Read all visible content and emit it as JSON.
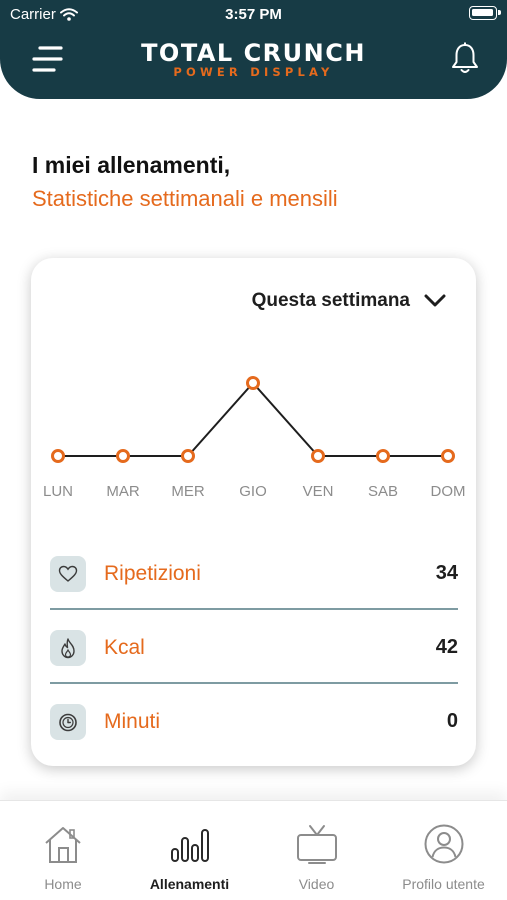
{
  "status_bar": {
    "carrier": "Carrier",
    "time": "3:57 PM"
  },
  "header": {
    "logo_title": "TOTAL CRUNCH",
    "logo_subtitle": "POWER DISPLAY"
  },
  "page": {
    "title": "I miei allenamenti,",
    "subtitle": "Statistiche settimanali e mensili"
  },
  "card": {
    "period_selected": "Questa settimana",
    "stats": [
      {
        "label": "Ripetizioni",
        "value": "34",
        "icon": "heart-icon"
      },
      {
        "label": "Kcal",
        "value": "42",
        "icon": "flame-icon"
      },
      {
        "label": "Minuti",
        "value": "0",
        "icon": "stopwatch-icon"
      }
    ]
  },
  "chart_data": {
    "type": "line",
    "categories": [
      "LUN",
      "MAR",
      "MER",
      "GIO",
      "VEN",
      "SAB",
      "DOM"
    ],
    "values": [
      0,
      0,
      0,
      1,
      0,
      0,
      0
    ],
    "ylim": [
      0,
      1
    ],
    "grid": false,
    "line_color": "#1e1e1e",
    "marker_color": "#e56a1d"
  },
  "tabbar": {
    "tabs": [
      {
        "label": "Home",
        "icon": "home-icon",
        "active": false
      },
      {
        "label": "Allenamenti",
        "icon": "bar-chart-icon",
        "active": true
      },
      {
        "label": "Video",
        "icon": "tv-icon",
        "active": false
      },
      {
        "label": "Profilo utente",
        "icon": "user-icon",
        "active": false
      }
    ]
  },
  "colors": {
    "header_bg": "#173b45",
    "accent": "#e56a1d",
    "icon_bg": "#d9e3e5",
    "divider": "#7e9ba2"
  }
}
